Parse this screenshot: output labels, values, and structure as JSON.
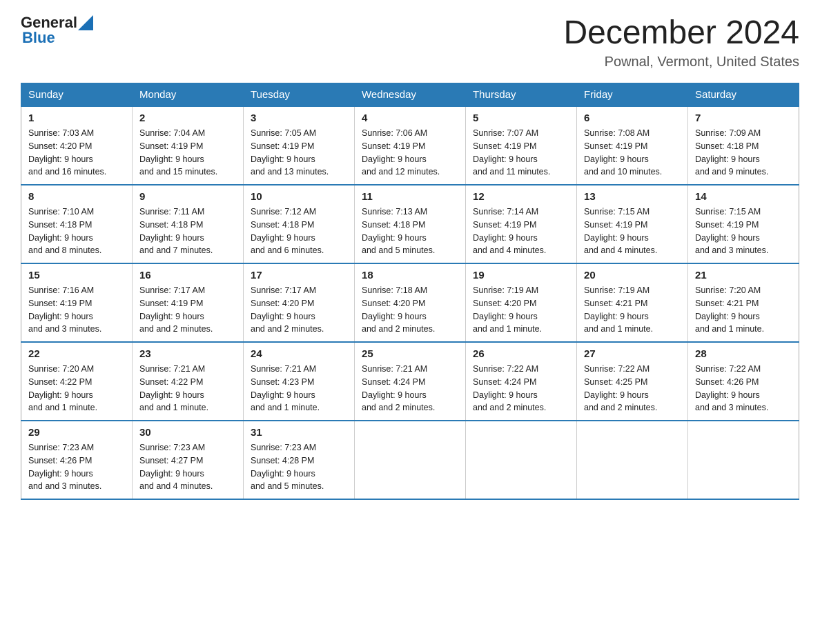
{
  "logo": {
    "general": "General",
    "blue": "Blue",
    "triangle_char": "▶"
  },
  "title": {
    "month_year": "December 2024",
    "location": "Pownal, Vermont, United States"
  },
  "days_of_week": [
    "Sunday",
    "Monday",
    "Tuesday",
    "Wednesday",
    "Thursday",
    "Friday",
    "Saturday"
  ],
  "weeks": [
    [
      {
        "day": "1",
        "sunrise": "Sunrise: 7:03 AM",
        "sunset": "Sunset: 4:20 PM",
        "daylight": "Daylight: 9 hours and 16 minutes."
      },
      {
        "day": "2",
        "sunrise": "Sunrise: 7:04 AM",
        "sunset": "Sunset: 4:19 PM",
        "daylight": "Daylight: 9 hours and 15 minutes."
      },
      {
        "day": "3",
        "sunrise": "Sunrise: 7:05 AM",
        "sunset": "Sunset: 4:19 PM",
        "daylight": "Daylight: 9 hours and 13 minutes."
      },
      {
        "day": "4",
        "sunrise": "Sunrise: 7:06 AM",
        "sunset": "Sunset: 4:19 PM",
        "daylight": "Daylight: 9 hours and 12 minutes."
      },
      {
        "day": "5",
        "sunrise": "Sunrise: 7:07 AM",
        "sunset": "Sunset: 4:19 PM",
        "daylight": "Daylight: 9 hours and 11 minutes."
      },
      {
        "day": "6",
        "sunrise": "Sunrise: 7:08 AM",
        "sunset": "Sunset: 4:19 PM",
        "daylight": "Daylight: 9 hours and 10 minutes."
      },
      {
        "day": "7",
        "sunrise": "Sunrise: 7:09 AM",
        "sunset": "Sunset: 4:18 PM",
        "daylight": "Daylight: 9 hours and 9 minutes."
      }
    ],
    [
      {
        "day": "8",
        "sunrise": "Sunrise: 7:10 AM",
        "sunset": "Sunset: 4:18 PM",
        "daylight": "Daylight: 9 hours and 8 minutes."
      },
      {
        "day": "9",
        "sunrise": "Sunrise: 7:11 AM",
        "sunset": "Sunset: 4:18 PM",
        "daylight": "Daylight: 9 hours and 7 minutes."
      },
      {
        "day": "10",
        "sunrise": "Sunrise: 7:12 AM",
        "sunset": "Sunset: 4:18 PM",
        "daylight": "Daylight: 9 hours and 6 minutes."
      },
      {
        "day": "11",
        "sunrise": "Sunrise: 7:13 AM",
        "sunset": "Sunset: 4:18 PM",
        "daylight": "Daylight: 9 hours and 5 minutes."
      },
      {
        "day": "12",
        "sunrise": "Sunrise: 7:14 AM",
        "sunset": "Sunset: 4:19 PM",
        "daylight": "Daylight: 9 hours and 4 minutes."
      },
      {
        "day": "13",
        "sunrise": "Sunrise: 7:15 AM",
        "sunset": "Sunset: 4:19 PM",
        "daylight": "Daylight: 9 hours and 4 minutes."
      },
      {
        "day": "14",
        "sunrise": "Sunrise: 7:15 AM",
        "sunset": "Sunset: 4:19 PM",
        "daylight": "Daylight: 9 hours and 3 minutes."
      }
    ],
    [
      {
        "day": "15",
        "sunrise": "Sunrise: 7:16 AM",
        "sunset": "Sunset: 4:19 PM",
        "daylight": "Daylight: 9 hours and 3 minutes."
      },
      {
        "day": "16",
        "sunrise": "Sunrise: 7:17 AM",
        "sunset": "Sunset: 4:19 PM",
        "daylight": "Daylight: 9 hours and 2 minutes."
      },
      {
        "day": "17",
        "sunrise": "Sunrise: 7:17 AM",
        "sunset": "Sunset: 4:20 PM",
        "daylight": "Daylight: 9 hours and 2 minutes."
      },
      {
        "day": "18",
        "sunrise": "Sunrise: 7:18 AM",
        "sunset": "Sunset: 4:20 PM",
        "daylight": "Daylight: 9 hours and 2 minutes."
      },
      {
        "day": "19",
        "sunrise": "Sunrise: 7:19 AM",
        "sunset": "Sunset: 4:20 PM",
        "daylight": "Daylight: 9 hours and 1 minute."
      },
      {
        "day": "20",
        "sunrise": "Sunrise: 7:19 AM",
        "sunset": "Sunset: 4:21 PM",
        "daylight": "Daylight: 9 hours and 1 minute."
      },
      {
        "day": "21",
        "sunrise": "Sunrise: 7:20 AM",
        "sunset": "Sunset: 4:21 PM",
        "daylight": "Daylight: 9 hours and 1 minute."
      }
    ],
    [
      {
        "day": "22",
        "sunrise": "Sunrise: 7:20 AM",
        "sunset": "Sunset: 4:22 PM",
        "daylight": "Daylight: 9 hours and 1 minute."
      },
      {
        "day": "23",
        "sunrise": "Sunrise: 7:21 AM",
        "sunset": "Sunset: 4:22 PM",
        "daylight": "Daylight: 9 hours and 1 minute."
      },
      {
        "day": "24",
        "sunrise": "Sunrise: 7:21 AM",
        "sunset": "Sunset: 4:23 PM",
        "daylight": "Daylight: 9 hours and 1 minute."
      },
      {
        "day": "25",
        "sunrise": "Sunrise: 7:21 AM",
        "sunset": "Sunset: 4:24 PM",
        "daylight": "Daylight: 9 hours and 2 minutes."
      },
      {
        "day": "26",
        "sunrise": "Sunrise: 7:22 AM",
        "sunset": "Sunset: 4:24 PM",
        "daylight": "Daylight: 9 hours and 2 minutes."
      },
      {
        "day": "27",
        "sunrise": "Sunrise: 7:22 AM",
        "sunset": "Sunset: 4:25 PM",
        "daylight": "Daylight: 9 hours and 2 minutes."
      },
      {
        "day": "28",
        "sunrise": "Sunrise: 7:22 AM",
        "sunset": "Sunset: 4:26 PM",
        "daylight": "Daylight: 9 hours and 3 minutes."
      }
    ],
    [
      {
        "day": "29",
        "sunrise": "Sunrise: 7:23 AM",
        "sunset": "Sunset: 4:26 PM",
        "daylight": "Daylight: 9 hours and 3 minutes."
      },
      {
        "day": "30",
        "sunrise": "Sunrise: 7:23 AM",
        "sunset": "Sunset: 4:27 PM",
        "daylight": "Daylight: 9 hours and 4 minutes."
      },
      {
        "day": "31",
        "sunrise": "Sunrise: 7:23 AM",
        "sunset": "Sunset: 4:28 PM",
        "daylight": "Daylight: 9 hours and 5 minutes."
      },
      null,
      null,
      null,
      null
    ]
  ]
}
